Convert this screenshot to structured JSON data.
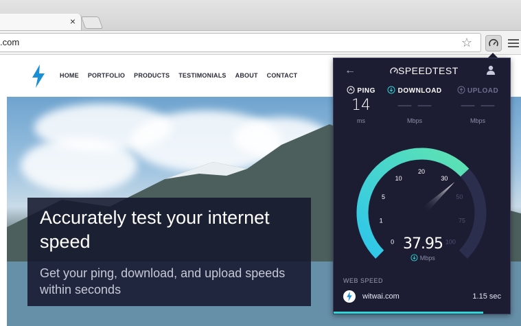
{
  "browser": {
    "tab_close": "×",
    "address": ".com",
    "star_icon": "star-icon",
    "extension_icon": "speedometer-icon",
    "menu_icon": "hamburger-menu-icon"
  },
  "site": {
    "nav": [
      "HOME",
      "PORTFOLIO",
      "PRODUCTS",
      "TESTIMONIALS",
      "ABOUT",
      "CONTACT"
    ],
    "hero_title": "Accurately test your internet speed",
    "hero_subtitle": "Get your ping, download, and upload speeds within seconds"
  },
  "speedtest": {
    "title": "SPEEDTEST",
    "ping": {
      "label": "PING",
      "value": "14",
      "unit": "ms"
    },
    "download": {
      "label": "DOWNLOAD",
      "value": "— —",
      "unit": "Mbps"
    },
    "upload": {
      "label": "UPLOAD",
      "value": "— —",
      "unit": "Mbps"
    },
    "gauge_ticks": [
      "0",
      "1",
      "5",
      "10",
      "20",
      "30",
      "50",
      "75",
      "100"
    ],
    "gauge_value": 37.95,
    "current_speed": "37.95",
    "current_unit": "Mbps",
    "web_speed_label": "WEB SPEED",
    "web_speed_site": "witwai.com",
    "web_speed_time": "1.15 sec",
    "progress_fraction": 0.85,
    "colors": {
      "accent": "#30d5d8",
      "gauge_start": "#2ec6ec",
      "gauge_end": "#5fe3b0",
      "panel": "#1c1d33"
    }
  }
}
